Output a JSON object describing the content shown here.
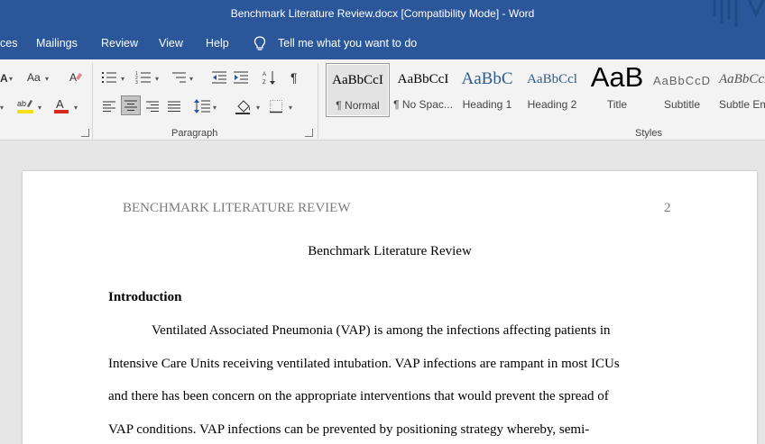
{
  "titlebar": {
    "title": "Benchmark Literature Review.docx [Compatibility Mode]  -  Word"
  },
  "tabs": {
    "items": [
      "ces",
      "Mailings",
      "Review",
      "View",
      "Help"
    ],
    "tell_me": "Tell me what you want to do"
  },
  "ribbon": {
    "font_group": {
      "change_case_label": "Aa"
    },
    "paragraph_label": "Paragraph",
    "styles_label": "Styles",
    "styles": [
      {
        "preview": "AaBbCcI",
        "name": "¶ Normal"
      },
      {
        "preview": "AaBbCcI",
        "name": "¶ No Spac..."
      },
      {
        "preview": "AaBbC",
        "name": "Heading 1"
      },
      {
        "preview": "AaBbCcl",
        "name": "Heading 2"
      },
      {
        "preview": "AaB",
        "name": "Title"
      },
      {
        "preview": "AaBbCcD",
        "name": "Subtitle"
      },
      {
        "preview": "AaBbCcD",
        "name": "Subtle Em"
      }
    ]
  },
  "document": {
    "header_title": "BENCHMARK LITERATURE REVIEW",
    "page_number": "2",
    "title": "Benchmark Literature Review",
    "heading": "Introduction",
    "lines": [
      "Ventilated Associated Pneumonia (VAP) is among the infections affecting patients in",
      "Intensive Care Units receiving ventilated intubation. VAP infections are rampant in most ICUs",
      "and there has been concern on the appropriate interventions that would prevent the spread of",
      "VAP conditions. VAP infections can be prevented by positioning strategy whereby, semi-"
    ]
  },
  "colors": {
    "word_blue": "#2b579a",
    "ribbon_bg": "#f3f3f3",
    "highlight_yellow": "#f5e11b",
    "font_red": "#d4291f"
  }
}
